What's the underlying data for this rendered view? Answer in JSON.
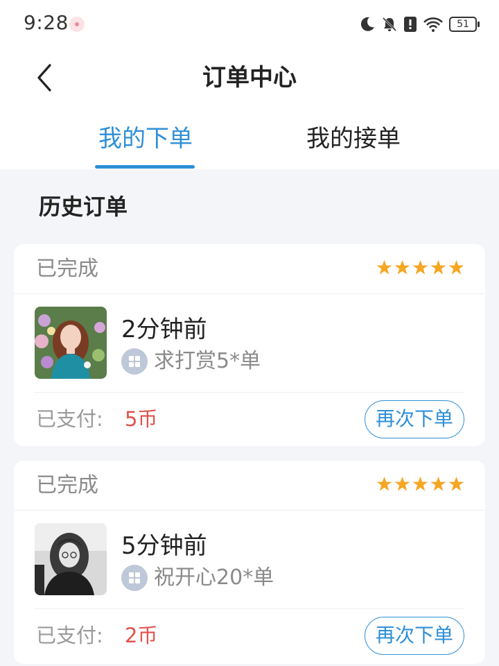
{
  "status_bar": {
    "time": "9:28",
    "battery_level": "51",
    "icons": [
      "notification-dot-icon",
      "moon-icon",
      "bell-off-icon",
      "alert-icon",
      "wifi-icon",
      "battery-icon"
    ]
  },
  "header": {
    "title": "订单中心",
    "back_icon": "chevron-left-icon"
  },
  "tabs": [
    {
      "label": "我的下单",
      "active": true
    },
    {
      "label": "我的接单",
      "active": false
    }
  ],
  "section_title": "历史订单",
  "colors": {
    "accent": "#2f8fd6",
    "star": "#f5a623",
    "price": "#e0524d",
    "muted": "#8a8a8a",
    "background": "#f3f5f8"
  },
  "orders": [
    {
      "status": "已完成",
      "rating": 5,
      "time_ago": "2分钟前",
      "service_icon": "grid-icon",
      "service": "求打赏5*单",
      "paid_label": "已支付:",
      "amount": "5币",
      "action": "再次下单"
    },
    {
      "status": "已完成",
      "rating": 5,
      "time_ago": "5分钟前",
      "service_icon": "grid-icon",
      "service": "祝开心20*单",
      "paid_label": "已支付:",
      "amount": "2币",
      "action": "再次下单"
    }
  ]
}
